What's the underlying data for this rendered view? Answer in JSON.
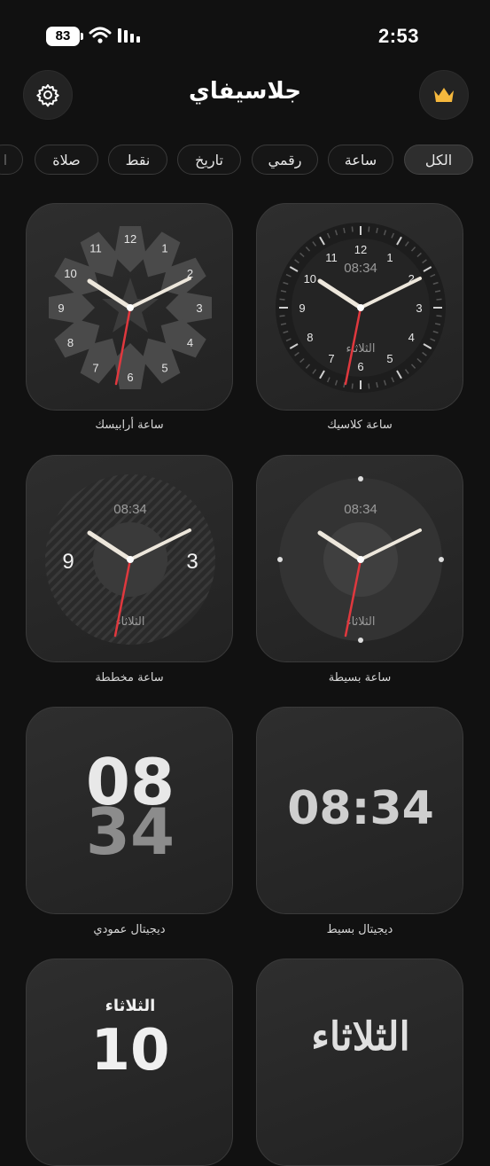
{
  "status_bar": {
    "time": "2:53",
    "battery": "83"
  },
  "header": {
    "title": "جلاسيفاي",
    "settings_icon": "gear-icon",
    "premium_icon": "crown-icon",
    "premium_color": "#f5b83d"
  },
  "tabs": [
    {
      "label": "الكل",
      "active": true
    },
    {
      "label": "ساعة"
    },
    {
      "label": "رقمي"
    },
    {
      "label": "تاريخ"
    },
    {
      "label": "نقط"
    },
    {
      "label": "صلاة"
    }
  ],
  "widgets": [
    {
      "label": "ساعة كلاسيك",
      "digital": "08:34",
      "day": "الثلاثاء"
    },
    {
      "label": "ساعة أرابيسك"
    },
    {
      "label": "ساعة بسيطة",
      "digital": "08:34",
      "day": "الثلاثاء"
    },
    {
      "label": "ساعة مخططة",
      "digital": "08:34",
      "day": "الثلاثاء",
      "left_num": "9",
      "right_num": "3"
    },
    {
      "label": "ديجيتال بسيط",
      "time": "08:34"
    },
    {
      "label": "ديجيتال عمودي",
      "hour": "08",
      "minute": "34"
    },
    {
      "label": "",
      "calligraphy": "الثلاثاء"
    },
    {
      "label": "",
      "day": "الثلاثاء",
      "date": "10"
    }
  ],
  "accent": {
    "second_hand": "#e0383e"
  }
}
